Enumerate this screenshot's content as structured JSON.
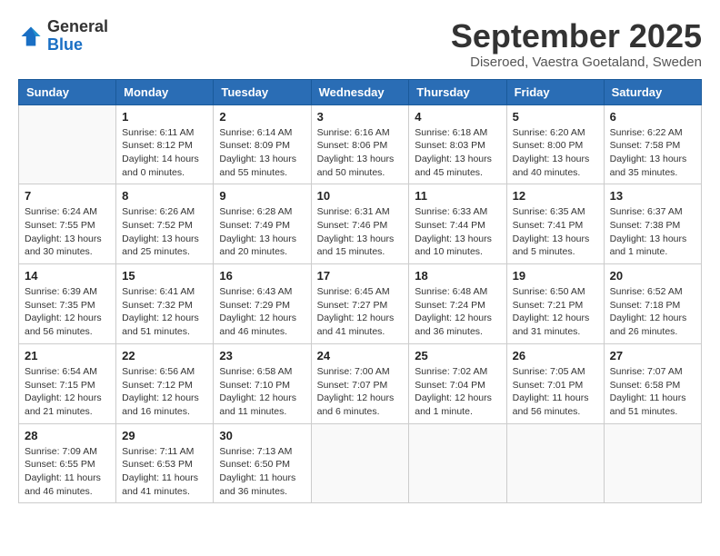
{
  "header": {
    "logo_line1": "General",
    "logo_line2": "Blue",
    "month_title": "September 2025",
    "location": "Diseroed, Vaestra Goetaland, Sweden"
  },
  "weekdays": [
    "Sunday",
    "Monday",
    "Tuesday",
    "Wednesday",
    "Thursday",
    "Friday",
    "Saturday"
  ],
  "weeks": [
    [
      {
        "day": "",
        "info": ""
      },
      {
        "day": "1",
        "info": "Sunrise: 6:11 AM\nSunset: 8:12 PM\nDaylight: 14 hours\nand 0 minutes."
      },
      {
        "day": "2",
        "info": "Sunrise: 6:14 AM\nSunset: 8:09 PM\nDaylight: 13 hours\nand 55 minutes."
      },
      {
        "day": "3",
        "info": "Sunrise: 6:16 AM\nSunset: 8:06 PM\nDaylight: 13 hours\nand 50 minutes."
      },
      {
        "day": "4",
        "info": "Sunrise: 6:18 AM\nSunset: 8:03 PM\nDaylight: 13 hours\nand 45 minutes."
      },
      {
        "day": "5",
        "info": "Sunrise: 6:20 AM\nSunset: 8:00 PM\nDaylight: 13 hours\nand 40 minutes."
      },
      {
        "day": "6",
        "info": "Sunrise: 6:22 AM\nSunset: 7:58 PM\nDaylight: 13 hours\nand 35 minutes."
      }
    ],
    [
      {
        "day": "7",
        "info": "Sunrise: 6:24 AM\nSunset: 7:55 PM\nDaylight: 13 hours\nand 30 minutes."
      },
      {
        "day": "8",
        "info": "Sunrise: 6:26 AM\nSunset: 7:52 PM\nDaylight: 13 hours\nand 25 minutes."
      },
      {
        "day": "9",
        "info": "Sunrise: 6:28 AM\nSunset: 7:49 PM\nDaylight: 13 hours\nand 20 minutes."
      },
      {
        "day": "10",
        "info": "Sunrise: 6:31 AM\nSunset: 7:46 PM\nDaylight: 13 hours\nand 15 minutes."
      },
      {
        "day": "11",
        "info": "Sunrise: 6:33 AM\nSunset: 7:44 PM\nDaylight: 13 hours\nand 10 minutes."
      },
      {
        "day": "12",
        "info": "Sunrise: 6:35 AM\nSunset: 7:41 PM\nDaylight: 13 hours\nand 5 minutes."
      },
      {
        "day": "13",
        "info": "Sunrise: 6:37 AM\nSunset: 7:38 PM\nDaylight: 13 hours\nand 1 minute."
      }
    ],
    [
      {
        "day": "14",
        "info": "Sunrise: 6:39 AM\nSunset: 7:35 PM\nDaylight: 12 hours\nand 56 minutes."
      },
      {
        "day": "15",
        "info": "Sunrise: 6:41 AM\nSunset: 7:32 PM\nDaylight: 12 hours\nand 51 minutes."
      },
      {
        "day": "16",
        "info": "Sunrise: 6:43 AM\nSunset: 7:29 PM\nDaylight: 12 hours\nand 46 minutes."
      },
      {
        "day": "17",
        "info": "Sunrise: 6:45 AM\nSunset: 7:27 PM\nDaylight: 12 hours\nand 41 minutes."
      },
      {
        "day": "18",
        "info": "Sunrise: 6:48 AM\nSunset: 7:24 PM\nDaylight: 12 hours\nand 36 minutes."
      },
      {
        "day": "19",
        "info": "Sunrise: 6:50 AM\nSunset: 7:21 PM\nDaylight: 12 hours\nand 31 minutes."
      },
      {
        "day": "20",
        "info": "Sunrise: 6:52 AM\nSunset: 7:18 PM\nDaylight: 12 hours\nand 26 minutes."
      }
    ],
    [
      {
        "day": "21",
        "info": "Sunrise: 6:54 AM\nSunset: 7:15 PM\nDaylight: 12 hours\nand 21 minutes."
      },
      {
        "day": "22",
        "info": "Sunrise: 6:56 AM\nSunset: 7:12 PM\nDaylight: 12 hours\nand 16 minutes."
      },
      {
        "day": "23",
        "info": "Sunrise: 6:58 AM\nSunset: 7:10 PM\nDaylight: 12 hours\nand 11 minutes."
      },
      {
        "day": "24",
        "info": "Sunrise: 7:00 AM\nSunset: 7:07 PM\nDaylight: 12 hours\nand 6 minutes."
      },
      {
        "day": "25",
        "info": "Sunrise: 7:02 AM\nSunset: 7:04 PM\nDaylight: 12 hours\nand 1 minute."
      },
      {
        "day": "26",
        "info": "Sunrise: 7:05 AM\nSunset: 7:01 PM\nDaylight: 11 hours\nand 56 minutes."
      },
      {
        "day": "27",
        "info": "Sunrise: 7:07 AM\nSunset: 6:58 PM\nDaylight: 11 hours\nand 51 minutes."
      }
    ],
    [
      {
        "day": "28",
        "info": "Sunrise: 7:09 AM\nSunset: 6:55 PM\nDaylight: 11 hours\nand 46 minutes."
      },
      {
        "day": "29",
        "info": "Sunrise: 7:11 AM\nSunset: 6:53 PM\nDaylight: 11 hours\nand 41 minutes."
      },
      {
        "day": "30",
        "info": "Sunrise: 7:13 AM\nSunset: 6:50 PM\nDaylight: 11 hours\nand 36 minutes."
      },
      {
        "day": "",
        "info": ""
      },
      {
        "day": "",
        "info": ""
      },
      {
        "day": "",
        "info": ""
      },
      {
        "day": "",
        "info": ""
      }
    ]
  ]
}
